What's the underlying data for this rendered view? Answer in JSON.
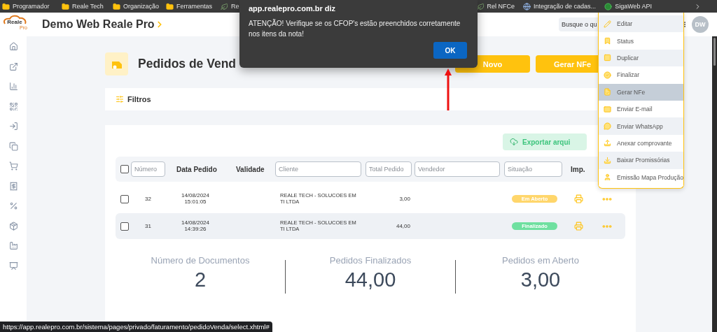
{
  "bookmarks_start": [
    {
      "label": "Programador",
      "kind": "folder"
    },
    {
      "label": "Reale Tech",
      "kind": "folder"
    },
    {
      "label": "Organização",
      "kind": "folder"
    },
    {
      "label": "Ferramentas",
      "kind": "folder"
    },
    {
      "label": "Re",
      "kind": "site"
    }
  ],
  "bookmarks_end": [
    {
      "label": "Rel NFCe",
      "kind": "site"
    },
    {
      "label": "Integração de cadas...",
      "kind": "globe"
    },
    {
      "label": "SigaWeb API",
      "kind": "green"
    }
  ],
  "logo": {
    "name": "Reale",
    "sub": "Pro"
  },
  "header": {
    "title": "Demo Web Reale Pro",
    "search": {
      "placeholder": "Busque o qu"
    },
    "avatar": "DW"
  },
  "page": {
    "title": "Pedidos de Vend",
    "buttons": [
      "Novo",
      "Gerar NFe"
    ]
  },
  "filters": {
    "label": "Filtros"
  },
  "export_button": "Exportar arqui",
  "table": {
    "columns": [
      {
        "kind": "checkbox",
        "checked": false
      },
      {
        "kind": "field",
        "placeholder": "Número"
      },
      {
        "kind": "label",
        "label": "Data Pedido"
      },
      {
        "kind": "label",
        "label": "Validade"
      },
      {
        "kind": "field",
        "placeholder": "Cliente"
      },
      {
        "kind": "field",
        "placeholder": "Total Pedido"
      },
      {
        "kind": "field",
        "placeholder": "Vendedor"
      },
      {
        "kind": "field",
        "placeholder": "Situação"
      },
      {
        "kind": "label",
        "label": "Imp."
      }
    ],
    "rows": [
      {
        "checked": false,
        "highlighted": false,
        "number": "32",
        "date": "14/08/2024",
        "time": "15:01:05",
        "client": "REALE TECH - SOLUCOES EM TI LTDA",
        "total": "3,00",
        "status": {
          "label": "Em Aberto",
          "kind": "open"
        }
      },
      {
        "checked": false,
        "highlighted": true,
        "number": "31",
        "date": "14/08/2024",
        "time": "14:39:26",
        "client": "REALE TECH - SOLUCOES EM TI LTDA",
        "total": "44,00",
        "status": {
          "label": "Finalizado",
          "kind": "done"
        }
      }
    ]
  },
  "stats": [
    {
      "label": "Número de Documentos",
      "value": "2"
    },
    {
      "label": "Pedidos Finalizados",
      "value": "44,00"
    },
    {
      "label": "Pedidos em Aberto",
      "value": "3,00"
    }
  ],
  "dialog": {
    "origin": "app.realepro.com.br diz",
    "message": "ATENÇÃO! Verifique se os CFOP's estão preenchidos corretamente nos itens da nota!",
    "button": "OK"
  },
  "menu": {
    "items": [
      {
        "label": "Editar",
        "selected": false
      },
      {
        "label": "Status",
        "selected": false
      },
      {
        "label": "Duplicar",
        "selected": false
      },
      {
        "label": "Finalizar",
        "selected": false
      },
      {
        "label": "Gerar NFe",
        "selected": true
      },
      {
        "label": "Enviar E-mail",
        "selected": false
      },
      {
        "label": "Enviar WhatsApp",
        "selected": false
      },
      {
        "label": "Anexar comprovante",
        "selected": false
      },
      {
        "label": "Baixar Promissórias",
        "selected": false
      },
      {
        "label": "Emissão Mapa Produção",
        "selected": false
      }
    ]
  },
  "status_url": "https://app.realepro.com.br/sistema/pages/privado/faturamento/pedidoVenda/select.xhtml#"
}
